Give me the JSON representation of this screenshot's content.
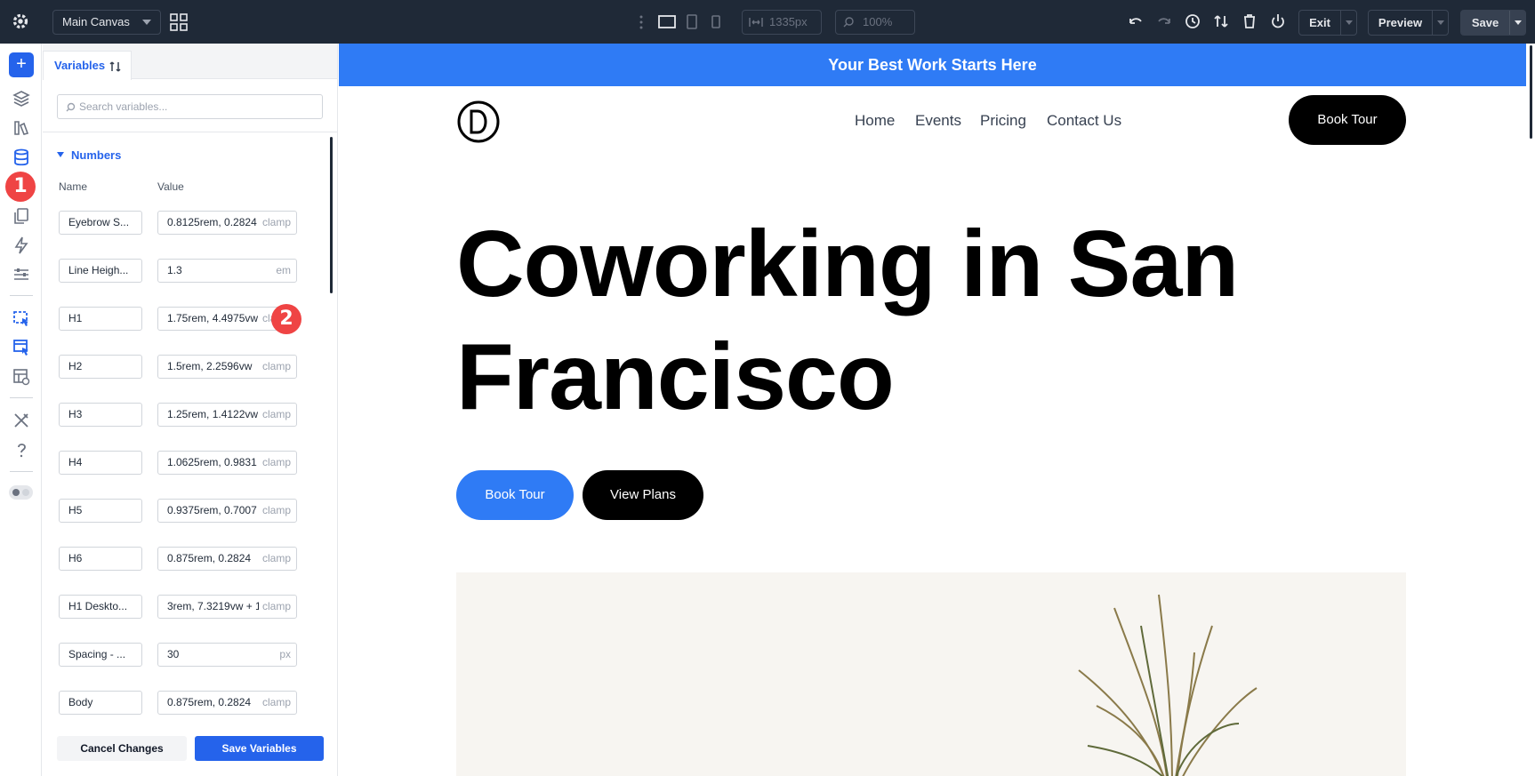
{
  "topbar": {
    "canvas_name": "Main Canvas",
    "width_value": "1335px",
    "zoom_value": "100%",
    "exit_label": "Exit",
    "preview_label": "Preview",
    "save_label": "Save"
  },
  "badges": {
    "one": "1",
    "two": "2"
  },
  "panel": {
    "tab_label": "Variables",
    "search_placeholder": "Search variables...",
    "section_title": "Numbers",
    "col_name": "Name",
    "col_value": "Value",
    "rows": [
      {
        "name": "Eyebrow S...",
        "value": "0.8125rem, 0.2824",
        "unit": "clamp"
      },
      {
        "name": "Line Heigh...",
        "value": "1.3",
        "unit": "em"
      },
      {
        "name": "H1",
        "value": "1.75rem, 4.4975vw",
        "unit": "clamp"
      },
      {
        "name": "H2",
        "value": "1.5rem, 2.2596vw",
        "unit": "clamp"
      },
      {
        "name": "H3",
        "value": "1.25rem, 1.4122vw",
        "unit": "clamp"
      },
      {
        "name": "H4",
        "value": "1.0625rem, 0.9831",
        "unit": "clamp"
      },
      {
        "name": "H5",
        "value": "0.9375rem, 0.7007",
        "unit": "clamp"
      },
      {
        "name": "H6",
        "value": "0.875rem, 0.2824",
        "unit": "clamp"
      },
      {
        "name": "H1 Deskto...",
        "value": "3rem, 7.3219vw + 1",
        "unit": "clamp"
      },
      {
        "name": "Spacing - ...",
        "value": "30",
        "unit": "px"
      },
      {
        "name": "Body",
        "value": "0.875rem, 0.2824",
        "unit": "clamp"
      }
    ],
    "cancel_label": "Cancel Changes",
    "save_label": "Save Variables"
  },
  "site": {
    "banner": "Your Best Work Starts Here",
    "nav": [
      "Home",
      "Events",
      "Pricing",
      "Contact Us"
    ],
    "nav_cta": "Book Tour",
    "hero_line1": "Coworking in San",
    "hero_line2": "Francisco",
    "btn_primary": "Book Tour",
    "btn_secondary": "View Plans"
  },
  "colors": {
    "accent": "#2563eb",
    "banner": "#2f7bf5",
    "badge": "#ef4444",
    "topbar": "#1f2937"
  }
}
